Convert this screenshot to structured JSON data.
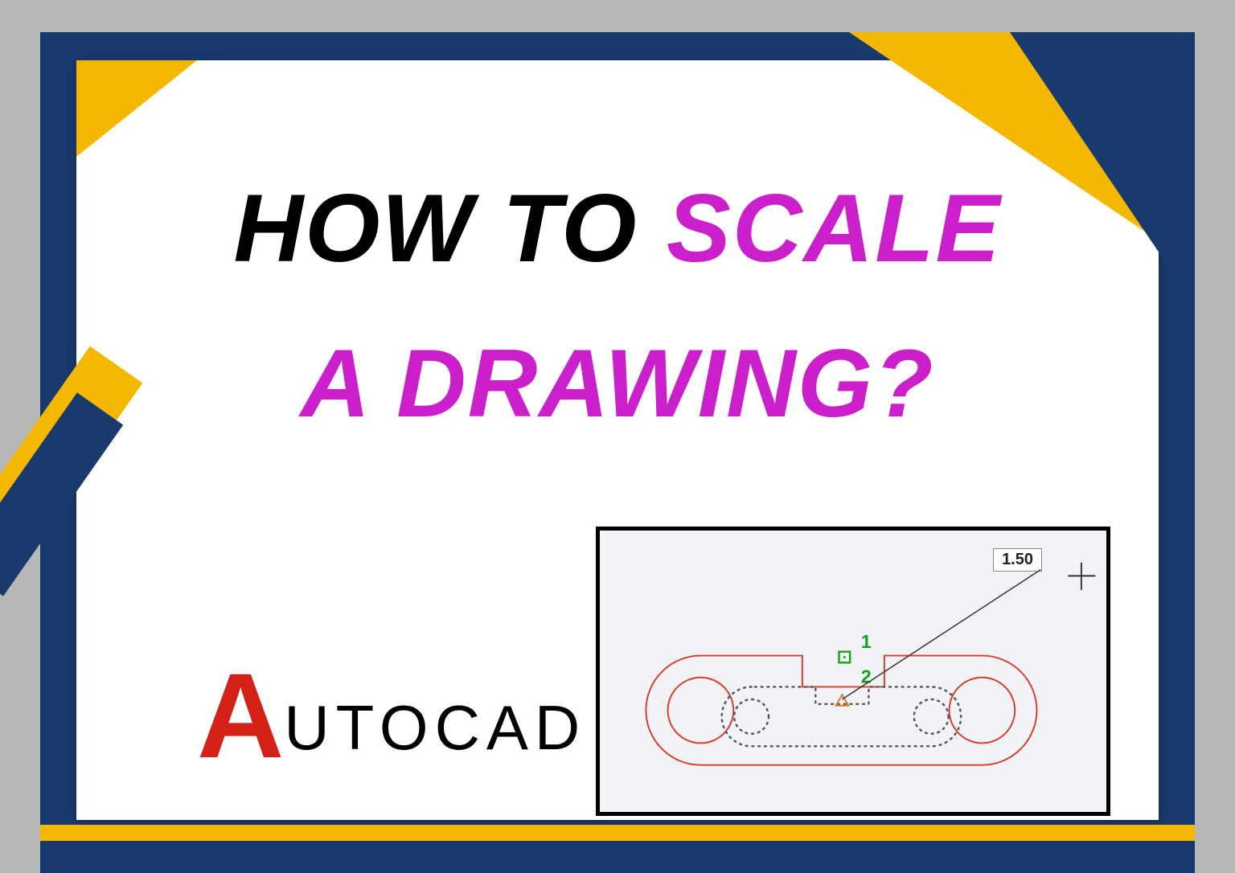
{
  "headline": {
    "line1_black": "HOW TO",
    "line1_magenta": "SCALE",
    "line2": "A DRAWING?"
  },
  "logo": {
    "big_letter": "A",
    "rest": "UTOCAD"
  },
  "panel": {
    "scale_value": "1.50",
    "marker1": "1",
    "marker2": "2"
  },
  "colors": {
    "navy": "#1a3a6e",
    "gold": "#f5b800",
    "magenta": "#cc1fcc",
    "autocad_red": "#d32118"
  }
}
